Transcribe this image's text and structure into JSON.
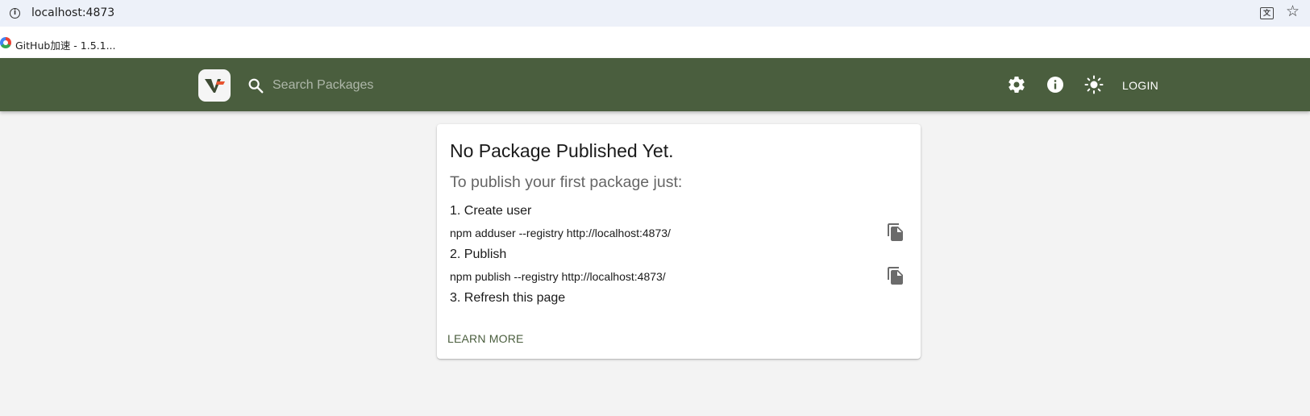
{
  "browser": {
    "url": "localhost:4873",
    "bookmark_label": "GitHub加速 - 1.5.1..."
  },
  "header": {
    "search_placeholder": "Search Packages",
    "login_label": "LOGIN",
    "background_color": "#4a5e3e",
    "icons": [
      "logo-icon",
      "search-icon",
      "gear-icon",
      "info-icon",
      "brightness-icon"
    ]
  },
  "card": {
    "title": "No Package Published Yet.",
    "subtitle": "To publish your first package just:",
    "steps": [
      {
        "label": "1. Create user",
        "command": "npm adduser --registry http://localhost:4873/"
      },
      {
        "label": "2. Publish",
        "command": "npm publish --registry http://localhost:4873/"
      },
      {
        "label": "3. Refresh this page"
      }
    ],
    "learn_more": "LEARN MORE"
  }
}
